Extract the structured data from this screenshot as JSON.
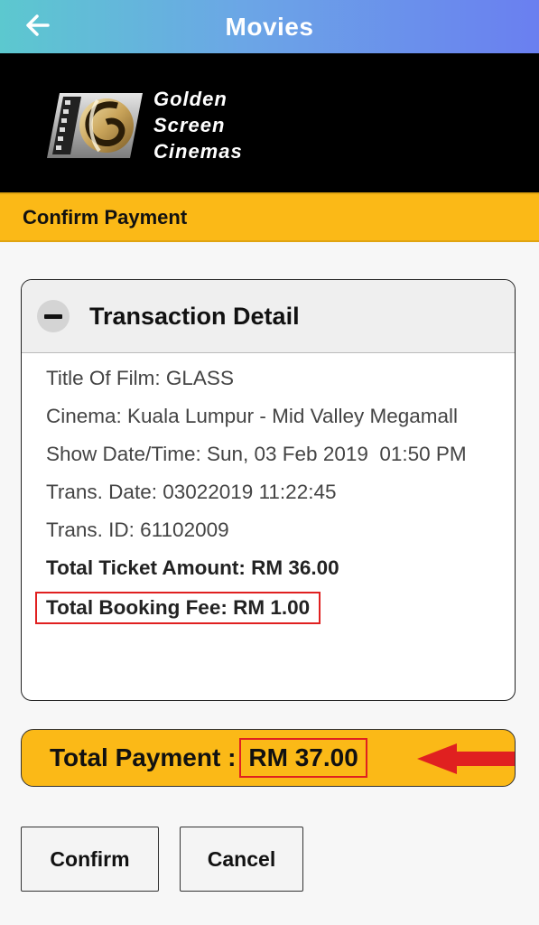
{
  "header": {
    "title": "Movies",
    "back_icon": "arrow-left-icon"
  },
  "banner": {
    "logo_lines": [
      "Golden",
      "Screen",
      "Cinemas"
    ],
    "background": "#000000"
  },
  "section": {
    "title": "Confirm Payment",
    "color": "#fbb917"
  },
  "transaction": {
    "title": "Transaction Detail",
    "title_of_film": "Title Of Film: GLASS",
    "cinema": "Cinema: Kuala Lumpur - Mid Valley Megamall",
    "show_datetime": "Show Date/Time: Sun, 03 Feb 2019  01:50 PM",
    "trans_date": "Trans. Date: 03022019 11:22:45",
    "trans_id": "Trans. ID: 61102009",
    "total_ticket_amount": "Total Ticket Amount: RM 36.00",
    "total_booking_fee": "Total Booking Fee: RM 1.00"
  },
  "total": {
    "label": "Total Payment :",
    "value": "RM 37.00",
    "highlight_color": "#e02020"
  },
  "buttons": {
    "confirm": "Confirm",
    "cancel": "Cancel"
  }
}
